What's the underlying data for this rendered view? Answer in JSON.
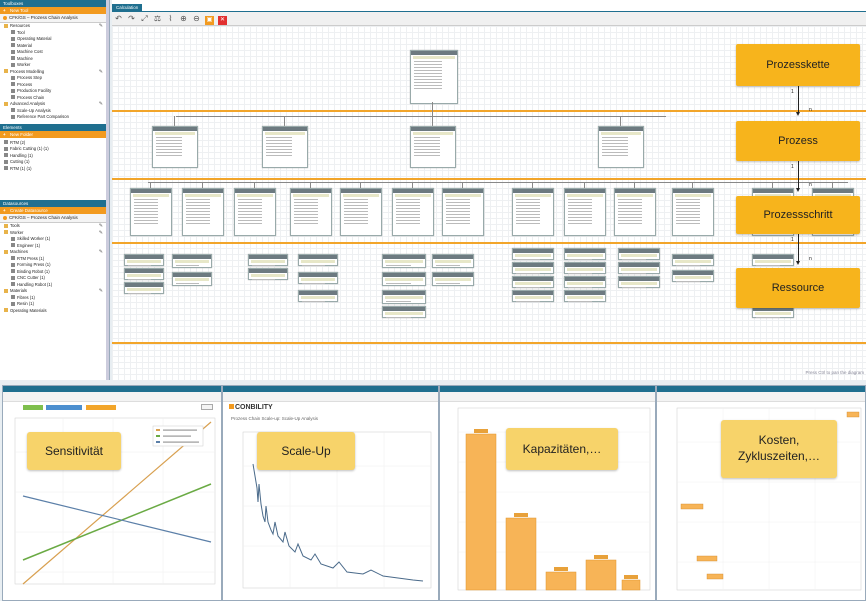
{
  "sidebar": {
    "toolboxes": {
      "title": "Toolboxes",
      "new_button": "New Tool",
      "breadcrumb": "CFK/GS – Prozess Chain Analysis",
      "items": [
        {
          "label": "Resources",
          "level": 1,
          "icon": "folder-icon",
          "edit": true
        },
        {
          "label": "Tool",
          "level": 2,
          "icon": "tool-icon"
        },
        {
          "label": "Operating Material",
          "level": 2,
          "icon": "material-icon"
        },
        {
          "label": "Material",
          "level": 2,
          "icon": "material-icon"
        },
        {
          "label": "Machine Cost",
          "level": 2,
          "icon": "machine-icon"
        },
        {
          "label": "Machine",
          "level": 2,
          "icon": "machine-icon"
        },
        {
          "label": "Worker",
          "level": 2,
          "icon": "worker-icon"
        },
        {
          "label": "Process Modelling",
          "level": 1,
          "icon": "folder-icon",
          "edit": true
        },
        {
          "label": "Process Step",
          "level": 2,
          "icon": "process-step-icon"
        },
        {
          "label": "Process",
          "level": 2,
          "icon": "process-icon"
        },
        {
          "label": "Production Facility",
          "level": 2,
          "icon": "facility-icon"
        },
        {
          "label": "Process Chain",
          "level": 2,
          "icon": "chain-icon"
        },
        {
          "label": "Advanced Analysis",
          "level": 1,
          "icon": "folder-icon",
          "edit": true
        },
        {
          "label": "Scale-Up Analysis",
          "level": 2,
          "icon": "analysis-icon"
        },
        {
          "label": "Reference Part Comparison",
          "level": 2,
          "icon": "comparison-icon"
        }
      ]
    },
    "elements": {
      "title": "Elements",
      "new_button": "New Folder",
      "items": [
        {
          "label": "RTM (2)",
          "level": 1,
          "icon": "process-icon"
        },
        {
          "label": "Fabric Cutting (1) (1)",
          "level": 1,
          "icon": "process-icon"
        },
        {
          "label": "Handling (1)",
          "level": 1,
          "icon": "process-icon"
        },
        {
          "label": "Cutting (1)",
          "level": 1,
          "icon": "process-icon"
        },
        {
          "label": "RTM (1) (1)",
          "level": 1,
          "icon": "process-icon"
        }
      ]
    },
    "datasources": {
      "title": "Datasources",
      "new_button": "Create Datasource",
      "breadcrumb": "CFK/GS – Prozess Chain Analysis",
      "items": [
        {
          "label": "Tools",
          "level": 1,
          "icon": "folder-icon",
          "edit": true
        },
        {
          "label": "Worker",
          "level": 1,
          "icon": "folder-icon",
          "edit": true
        },
        {
          "label": "Skilled Worker (1)",
          "level": 2,
          "icon": "worker-icon"
        },
        {
          "label": "Engineer (1)",
          "level": 2,
          "icon": "worker-icon"
        },
        {
          "label": "Machines",
          "level": 1,
          "icon": "folder-icon",
          "edit": true
        },
        {
          "label": "RTM Press (1)",
          "level": 2,
          "icon": "machine-icon"
        },
        {
          "label": "Forming Press (1)",
          "level": 2,
          "icon": "machine-icon"
        },
        {
          "label": "Binding Robot (1)",
          "level": 2,
          "icon": "machine-icon"
        },
        {
          "label": "CNC Cutter (1)",
          "level": 2,
          "icon": "machine-icon"
        },
        {
          "label": "Handling Robot (1)",
          "level": 2,
          "icon": "machine-icon"
        },
        {
          "label": "Materials",
          "level": 1,
          "icon": "folder-icon",
          "edit": true
        },
        {
          "label": "Fibres (1)",
          "level": 2,
          "icon": "material-icon"
        },
        {
          "label": "Resin (1)",
          "level": 2,
          "icon": "material-icon"
        },
        {
          "label": "Operating Materials",
          "level": 1,
          "icon": "folder-icon"
        }
      ]
    }
  },
  "calculation": {
    "tab_label": "Calculation",
    "toolbar": [
      "undo-icon",
      "redo-icon",
      "fit-icon",
      "tree-layout-icon",
      "chart-icon",
      "zoom-in-icon",
      "zoom-out-icon",
      "overview-icon",
      "close-icon"
    ],
    "hint": "Press Ctrl to pan the diagram",
    "levels": [
      {
        "label": "Prozesskette"
      },
      {
        "label": "Prozess"
      },
      {
        "label": "Prozessschritt"
      },
      {
        "label": "Ressource"
      }
    ],
    "cardinality": [
      {
        "one": "1",
        "many": "n"
      },
      {
        "one": "1",
        "many": "n"
      },
      {
        "one": "1",
        "many": "n"
      }
    ]
  },
  "panels": [
    {
      "callout": "Sensitivität"
    },
    {
      "callout": "Scale-Up",
      "brand": "CONBILITY",
      "subtitle": "Prozess Chain Scale-up: Scale-Up Analysis"
    },
    {
      "callout": "Kapazitäten,…"
    },
    {
      "callout": "Kosten,\nZykluszeiten,…"
    }
  ],
  "colors": {
    "accent": "#f7b41c",
    "header": "#1f6f8f",
    "orange": "#f29a1f"
  }
}
